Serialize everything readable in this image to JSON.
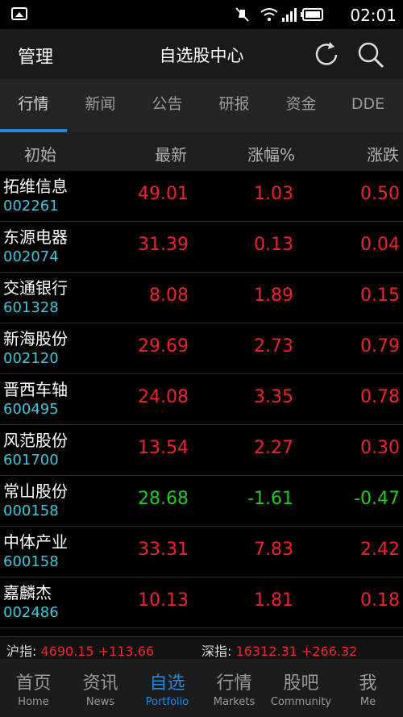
{
  "status_bar": {
    "time": "02:01"
  },
  "header": {
    "manage_label": "管理",
    "title": "自选股中心"
  },
  "tabs": [
    "行情",
    "新闻",
    "公告",
    "研报",
    "资金",
    "DDE"
  ],
  "columns": {
    "name": "初始",
    "price": "最新",
    "pct": "涨幅%",
    "change": "涨跌"
  },
  "stocks": [
    {
      "name": "拓维信息",
      "code": "002261",
      "price": "49.01",
      "pct": "1.03",
      "change": "0.50",
      "dir": "up"
    },
    {
      "name": "东源电器",
      "code": "002074",
      "price": "31.39",
      "pct": "0.13",
      "change": "0.04",
      "dir": "up"
    },
    {
      "name": "交通银行",
      "code": "601328",
      "price": "8.08",
      "pct": "1.89",
      "change": "0.15",
      "dir": "up"
    },
    {
      "name": "新海股份",
      "code": "002120",
      "price": "29.69",
      "pct": "2.73",
      "change": "0.79",
      "dir": "up"
    },
    {
      "name": "晋西车轴",
      "code": "600495",
      "price": "24.08",
      "pct": "3.35",
      "change": "0.78",
      "dir": "up"
    },
    {
      "name": "风范股份",
      "code": "601700",
      "price": "13.54",
      "pct": "2.27",
      "change": "0.30",
      "dir": "up"
    },
    {
      "name": "常山股份",
      "code": "000158",
      "price": "28.68",
      "pct": "-1.61",
      "change": "-0.47",
      "dir": "down"
    },
    {
      "name": "中体产业",
      "code": "600158",
      "price": "33.31",
      "pct": "7.83",
      "change": "2.42",
      "dir": "up"
    },
    {
      "name": "嘉麟杰",
      "code": "002486",
      "price": "10.13",
      "pct": "1.81",
      "change": "0.18",
      "dir": "up"
    }
  ],
  "ticker": {
    "sh_label": "沪指:",
    "sh_value": "4690.15 +113.66",
    "sz_label": "深指:",
    "sz_value": "16312.31 +266.32"
  },
  "bottom_nav": [
    {
      "zh": "首页",
      "en": "Home"
    },
    {
      "zh": "资讯",
      "en": "News"
    },
    {
      "zh": "自选",
      "en": "Portfolio"
    },
    {
      "zh": "行情",
      "en": "Markets"
    },
    {
      "zh": "股吧",
      "en": "Community"
    },
    {
      "zh": "我",
      "en": "Me"
    }
  ],
  "active_tab_index": 0,
  "active_nav_index": 2,
  "icons": {
    "status_left": "image-icon",
    "status_right": [
      "mute-icon",
      "wifi-icon",
      "signal-icon",
      "battery-icon"
    ],
    "header_right": [
      "refresh-icon",
      "search-icon"
    ]
  },
  "colors": {
    "up": "#f0212e",
    "down": "#1fc91f",
    "accent": "#1e88e5",
    "code": "#3cc6d8"
  }
}
